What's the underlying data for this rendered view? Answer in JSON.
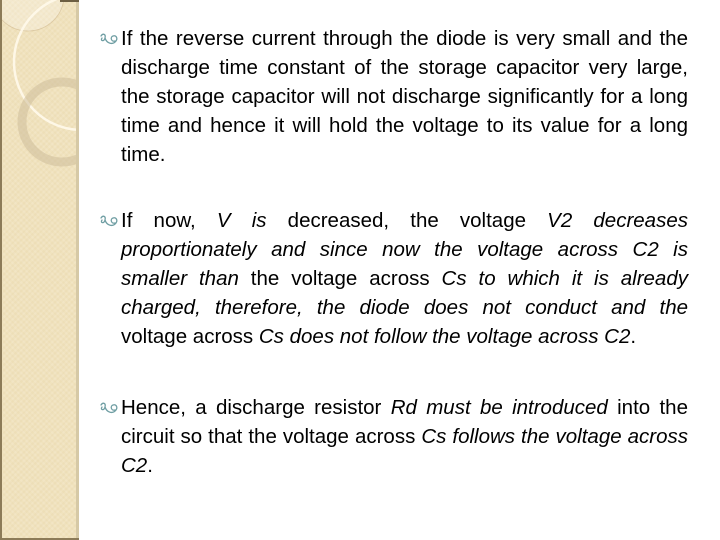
{
  "slide": {
    "bullet_icon": "wingdings-floral-bullet-icon",
    "colors": {
      "bullet": "#6f9ea3",
      "text": "#000000",
      "sidebar": "#f0e2bd",
      "sidebar_border": "#8c7b58"
    },
    "bullets": [
      {
        "segments": [
          {
            "text": "If the reverse current through the diode is very small and the discharge time constant of the storage capacitor very large, the storage capacitor will not discharge significantly for a long time and hence it will hold the voltage to its value for a long time.",
            "italic": false
          }
        ]
      },
      {
        "segments": [
          {
            "text": "If now, ",
            "italic": false
          },
          {
            "text": "V is",
            "italic": true
          },
          {
            "text": " decreased, the voltage ",
            "italic": false
          },
          {
            "text": "V2 decreases proportionately and since now the voltage across C2 is smaller than",
            "italic": true
          },
          {
            "text": " the voltage across ",
            "italic": false
          },
          {
            "text": "Cs to which it is already charged, therefore, the diode does not conduct and the",
            "italic": true
          },
          {
            "text": " voltage across ",
            "italic": false
          },
          {
            "text": "Cs does not follow the voltage across C2",
            "italic": true
          },
          {
            "text": ".",
            "italic": false
          }
        ]
      },
      {
        "segments": [
          {
            "text": "Hence, a discharge resistor ",
            "italic": false
          },
          {
            "text": "Rd must be introduced",
            "italic": true
          },
          {
            "text": " into the circuit so that the voltage across ",
            "italic": false
          },
          {
            "text": "Cs follows the voltage across C2",
            "italic": true
          },
          {
            "text": ".",
            "italic": false
          }
        ]
      }
    ]
  }
}
